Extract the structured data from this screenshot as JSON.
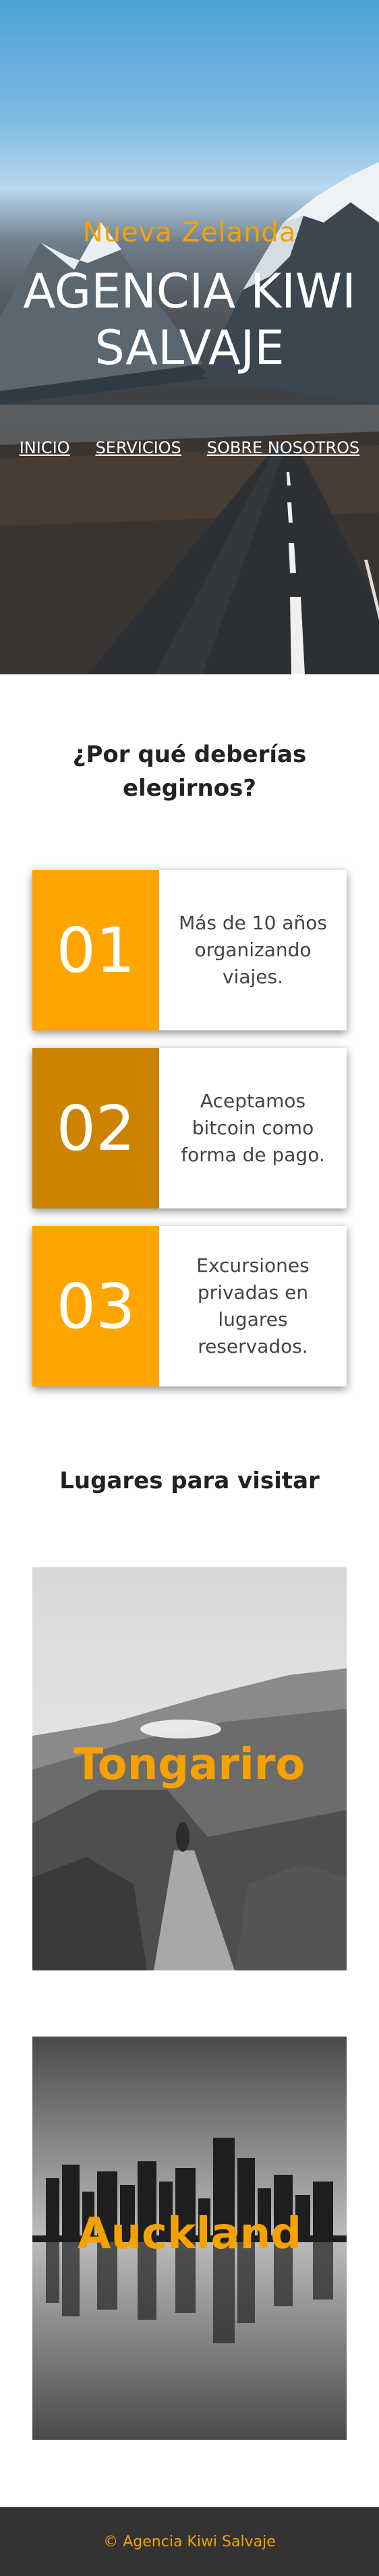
{
  "hero": {
    "subtitle": "Nueva Zelanda",
    "title_line1": "AGENCIA KIWI",
    "title_line2": "SALVAJE",
    "nav": [
      {
        "label": "INICIO"
      },
      {
        "label": "SERVICIOS"
      },
      {
        "label": "SOBRE NOSOTROS"
      }
    ]
  },
  "why": {
    "title_line1": "¿Por qué deberías",
    "title_line2": "elegirnos?",
    "cards": [
      {
        "number": "01",
        "text": "Más de 10 años organizando viajes.",
        "color": "#ffa500"
      },
      {
        "number": "02",
        "text": "Aceptamos bitcoin como forma de pago.",
        "color": "#cc8400"
      },
      {
        "number": "03",
        "text": "Excursiones privadas en lugares reservados.",
        "color": "#ffa500"
      }
    ]
  },
  "places": {
    "title": "Lugares para visitar",
    "items": [
      {
        "name": "Tongariro"
      },
      {
        "name": "Auckland"
      }
    ]
  },
  "footer": {
    "text": "© Agencia Kiwi Salvaje"
  },
  "colors": {
    "accent": "#ffa500",
    "accent_dark": "#cc8400",
    "footer_bg": "#333333"
  }
}
